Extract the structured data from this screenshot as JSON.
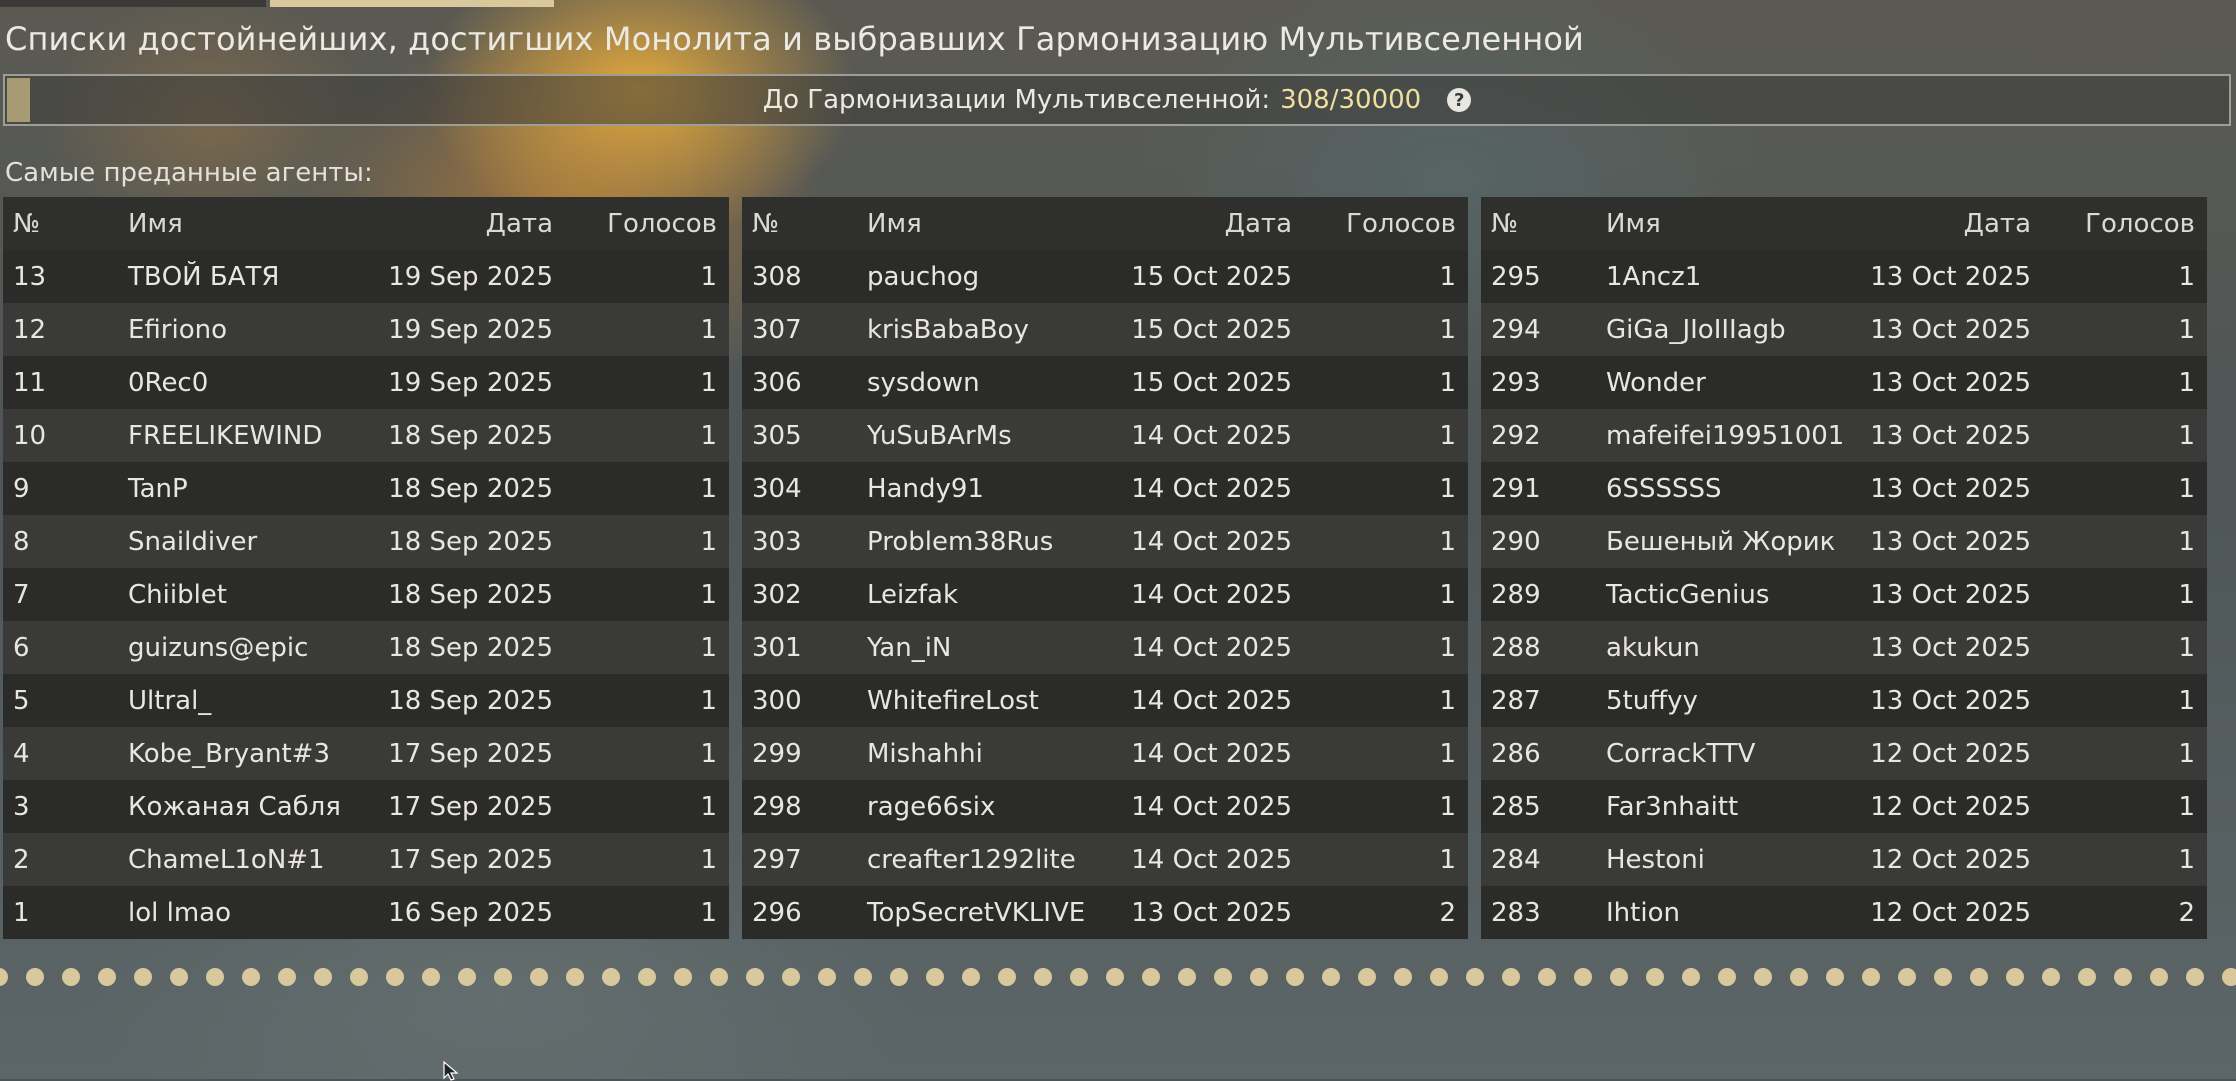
{
  "title": "Списки достойнейших, достигших Монолита и выбравших Гармонизацию Мультивселенной",
  "progress": {
    "label": "До Гармонизации Мультивселенной:",
    "value_text": "308/30000",
    "current": 308,
    "total": 30000
  },
  "section_label": "Самые преданные агенты:",
  "columns": {
    "num": "№",
    "name": "Имя",
    "date": "Дата",
    "votes": "Голосов"
  },
  "tables": [
    {
      "rows": [
        {
          "num": "13",
          "name": "ТВОЙ БАТЯ",
          "date": "19 Sep 2025",
          "votes": "1"
        },
        {
          "num": "12",
          "name": "Efiriono",
          "date": "19 Sep 2025",
          "votes": "1"
        },
        {
          "num": "11",
          "name": "0Rec0",
          "date": "19 Sep 2025",
          "votes": "1"
        },
        {
          "num": "10",
          "name": "FREELIKEWIND",
          "date": "18 Sep 2025",
          "votes": "1"
        },
        {
          "num": "9",
          "name": "TanP",
          "date": "18 Sep 2025",
          "votes": "1"
        },
        {
          "num": "8",
          "name": "Snaildiver",
          "date": "18 Sep 2025",
          "votes": "1"
        },
        {
          "num": "7",
          "name": "Chiiblet",
          "date": "18 Sep 2025",
          "votes": "1"
        },
        {
          "num": "6",
          "name": "guizuns@epic",
          "date": "18 Sep 2025",
          "votes": "1"
        },
        {
          "num": "5",
          "name": "Ultral_",
          "date": "18 Sep 2025",
          "votes": "1"
        },
        {
          "num": "4",
          "name": "Kobe_Bryant#3",
          "date": "17 Sep 2025",
          "votes": "1"
        },
        {
          "num": "3",
          "name": "Кожаная Сабля",
          "date": "17 Sep 2025",
          "votes": "1"
        },
        {
          "num": "2",
          "name": "ChameL1oN#1",
          "date": "17 Sep 2025",
          "votes": "1"
        },
        {
          "num": "1",
          "name": "lol lmao",
          "date": "16 Sep 2025",
          "votes": "1"
        }
      ]
    },
    {
      "rows": [
        {
          "num": "308",
          "name": "pauchog",
          "date": "15 Oct 2025",
          "votes": "1"
        },
        {
          "num": "307",
          "name": "krisBabaBoy",
          "date": "15 Oct 2025",
          "votes": "1"
        },
        {
          "num": "306",
          "name": "sysdown",
          "date": "15 Oct 2025",
          "votes": "1"
        },
        {
          "num": "305",
          "name": "YuSuBArMs",
          "date": "14 Oct 2025",
          "votes": "1"
        },
        {
          "num": "304",
          "name": "Handy91",
          "date": "14 Oct 2025",
          "votes": "1"
        },
        {
          "num": "303",
          "name": "Problem38Rus",
          "date": "14 Oct 2025",
          "votes": "1"
        },
        {
          "num": "302",
          "name": "Leizfak",
          "date": "14 Oct 2025",
          "votes": "1"
        },
        {
          "num": "301",
          "name": "Yan_iN",
          "date": "14 Oct 2025",
          "votes": "1"
        },
        {
          "num": "300",
          "name": "WhitefireLost",
          "date": "14 Oct 2025",
          "votes": "1"
        },
        {
          "num": "299",
          "name": "Mishahhi",
          "date": "14 Oct 2025",
          "votes": "1"
        },
        {
          "num": "298",
          "name": "rage66six",
          "date": "14 Oct 2025",
          "votes": "1"
        },
        {
          "num": "297",
          "name": "creafter1292lite",
          "date": "14 Oct 2025",
          "votes": "1"
        },
        {
          "num": "296",
          "name": "TopSecretVKLIVE",
          "date": "13 Oct 2025",
          "votes": "2"
        }
      ]
    },
    {
      "rows": [
        {
          "num": "295",
          "name": "1Ancz1",
          "date": "13 Oct 2025",
          "votes": "1"
        },
        {
          "num": "294",
          "name": "GiGa_JIoIIIagb",
          "date": "13 Oct 2025",
          "votes": "1"
        },
        {
          "num": "293",
          "name": "Wonder",
          "date": "13 Oct 2025",
          "votes": "1"
        },
        {
          "num": "292",
          "name": "mafeifei19951001",
          "date": "13 Oct 2025",
          "votes": "1"
        },
        {
          "num": "291",
          "name": "6SSSSSS",
          "date": "13 Oct 2025",
          "votes": "1"
        },
        {
          "num": "290",
          "name": "Бешеный Жорик",
          "date": "13 Oct 2025",
          "votes": "1"
        },
        {
          "num": "289",
          "name": "TacticGenius",
          "date": "13 Oct 2025",
          "votes": "1"
        },
        {
          "num": "288",
          "name": "akukun",
          "date": "13 Oct 2025",
          "votes": "1"
        },
        {
          "num": "287",
          "name": "5tuffyy",
          "date": "13 Oct 2025",
          "votes": "1"
        },
        {
          "num": "286",
          "name": "CorrackTTV",
          "date": "12 Oct 2025",
          "votes": "1"
        },
        {
          "num": "285",
          "name": "Far3nhaitt",
          "date": "12 Oct 2025",
          "votes": "1"
        },
        {
          "num": "284",
          "name": "Hestoni",
          "date": "12 Oct 2025",
          "votes": "1"
        },
        {
          "num": "283",
          "name": "Ihtion",
          "date": "12 Oct 2025",
          "votes": "2"
        }
      ]
    }
  ],
  "icons": {
    "help": "question-circle-icon",
    "cursor": "mouse-pointer-icon"
  },
  "colors": {
    "accent": "#d8c89b",
    "progress_value": "#f1dfa0",
    "row_dark": "#2b2b2a",
    "row_light": "#3a3a39",
    "header": "#2f2f2e"
  }
}
